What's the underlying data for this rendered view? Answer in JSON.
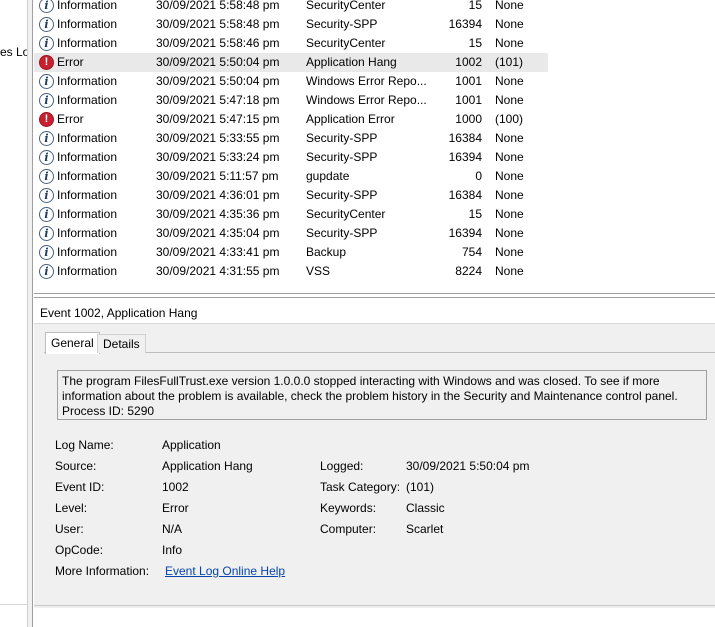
{
  "nav": {
    "fragment": "es Lo"
  },
  "events": [
    {
      "level": "Information",
      "icon": "info",
      "date": "30/09/2021 5:58:48 pm",
      "source": "SecurityCenter",
      "id": "15",
      "task": "None"
    },
    {
      "level": "Information",
      "icon": "info",
      "date": "30/09/2021 5:58:48 pm",
      "source": "Security-SPP",
      "id": "16394",
      "task": "None"
    },
    {
      "level": "Information",
      "icon": "info",
      "date": "30/09/2021 5:58:46 pm",
      "source": "SecurityCenter",
      "id": "15",
      "task": "None"
    },
    {
      "level": "Error",
      "icon": "err",
      "date": "30/09/2021 5:50:04 pm",
      "source": "Application Hang",
      "id": "1002",
      "task": "(101)",
      "selected": true
    },
    {
      "level": "Information",
      "icon": "info",
      "date": "30/09/2021 5:50:04 pm",
      "source": "Windows Error Repo...",
      "id": "1001",
      "task": "None"
    },
    {
      "level": "Information",
      "icon": "info",
      "date": "30/09/2021 5:47:18 pm",
      "source": "Windows Error Repo...",
      "id": "1001",
      "task": "None"
    },
    {
      "level": "Error",
      "icon": "err",
      "date": "30/09/2021 5:47:15 pm",
      "source": "Application Error",
      "id": "1000",
      "task": "(100)"
    },
    {
      "level": "Information",
      "icon": "info",
      "date": "30/09/2021 5:33:55 pm",
      "source": "Security-SPP",
      "id": "16384",
      "task": "None"
    },
    {
      "level": "Information",
      "icon": "info",
      "date": "30/09/2021 5:33:24 pm",
      "source": "Security-SPP",
      "id": "16394",
      "task": "None"
    },
    {
      "level": "Information",
      "icon": "info",
      "date": "30/09/2021 5:11:57 pm",
      "source": "gupdate",
      "id": "0",
      "task": "None"
    },
    {
      "level": "Information",
      "icon": "info",
      "date": "30/09/2021 4:36:01 pm",
      "source": "Security-SPP",
      "id": "16384",
      "task": "None"
    },
    {
      "level": "Information",
      "icon": "info",
      "date": "30/09/2021 4:35:36 pm",
      "source": "SecurityCenter",
      "id": "15",
      "task": "None"
    },
    {
      "level": "Information",
      "icon": "info",
      "date": "30/09/2021 4:35:04 pm",
      "source": "Security-SPP",
      "id": "16394",
      "task": "None"
    },
    {
      "level": "Information",
      "icon": "info",
      "date": "30/09/2021 4:33:41 pm",
      "source": "Backup",
      "id": "754",
      "task": "None"
    },
    {
      "level": "Information",
      "icon": "info",
      "date": "30/09/2021 4:31:55 pm",
      "source": "VSS",
      "id": "8224",
      "task": "None"
    }
  ],
  "detail": {
    "title": "Event 1002, Application Hang",
    "tabs": {
      "general": "General",
      "details": "Details"
    },
    "message": [
      "The program FilesFullTrust.exe version 1.0.0.0 stopped interacting with Windows and was closed. To see if more",
      "information about the problem is available, check the problem history in the Security and Maintenance control panel.",
      " Process ID: 5290"
    ],
    "props": {
      "log_name_label": "Log Name:",
      "log_name": "Application",
      "source_label": "Source:",
      "source": "Application Hang",
      "logged_label": "Logged:",
      "logged": "30/09/2021 5:50:04 pm",
      "event_id_label": "Event ID:",
      "event_id": "1002",
      "task_category_label": "Task Category:",
      "task_category": "(101)",
      "level_label": "Level:",
      "level": "Error",
      "keywords_label": "Keywords:",
      "keywords": "Classic",
      "user_label": "User:",
      "user": "N/A",
      "computer_label": "Computer:",
      "computer": "Scarlet",
      "opcode_label": "OpCode:",
      "opcode": "Info",
      "more_info_label": "More Information:",
      "more_info_link": "Event Log Online Help"
    }
  }
}
